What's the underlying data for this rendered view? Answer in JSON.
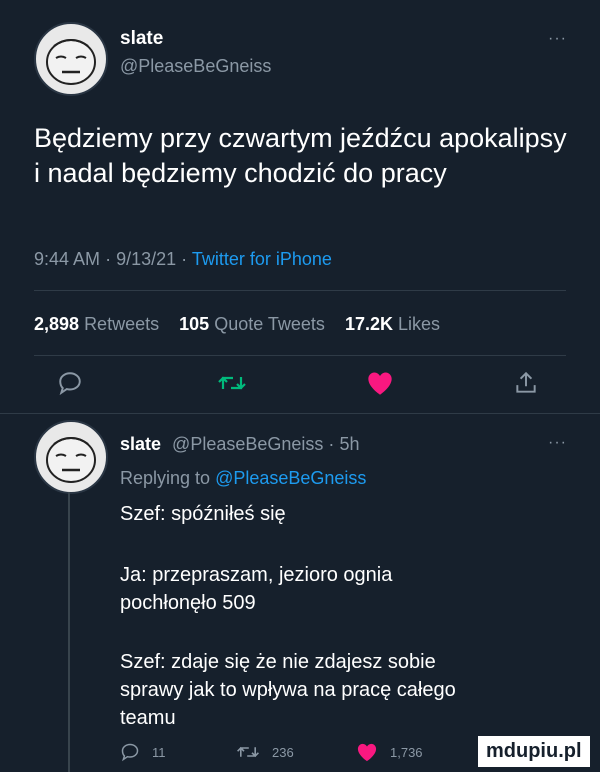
{
  "tweet": {
    "author_name": "slate",
    "author_handle": "@PleaseBeGneiss",
    "more": "···",
    "text": "Będziemy przy czwartym jeźdźcu apokalipsy i nadal będziemy chodzić do pracy",
    "time": "9:44 AM",
    "date": "9/13/21",
    "separator": "·",
    "source": "Twitter for iPhone",
    "stats": {
      "retweets_count": "2,898",
      "retweets_label": "Retweets",
      "quotes_count": "105",
      "quotes_label": "Quote Tweets",
      "likes_count": "17.2K",
      "likes_label": "Likes"
    },
    "colors": {
      "like": "#f91880",
      "retweet": "#00ba7c",
      "link": "#1d9bf0"
    }
  },
  "reply": {
    "author_name": "slate",
    "author_handle": "@PleaseBeGneiss",
    "age": "5h",
    "more": "···",
    "replying_prefix": "Replying to",
    "replying_to": "@PleaseBeGneiss",
    "lines": [
      "Szef: spóźniłeś się",
      "Ja: przepraszam, jezioro ognia",
      "pochłonęło 509",
      "Szef: zdaje się że nie zdajesz sobie",
      "sprawy jak to wpływa na pracę całego",
      "teamu"
    ],
    "counts": {
      "replies": "11",
      "retweets": "236",
      "likes": "1,736"
    }
  },
  "watermark": "mdupiu.pl",
  "icons": {
    "reply": "speech-bubble-icon",
    "retweet": "retweet-arrows-icon",
    "like": "heart-icon",
    "share": "share-upload-icon"
  }
}
